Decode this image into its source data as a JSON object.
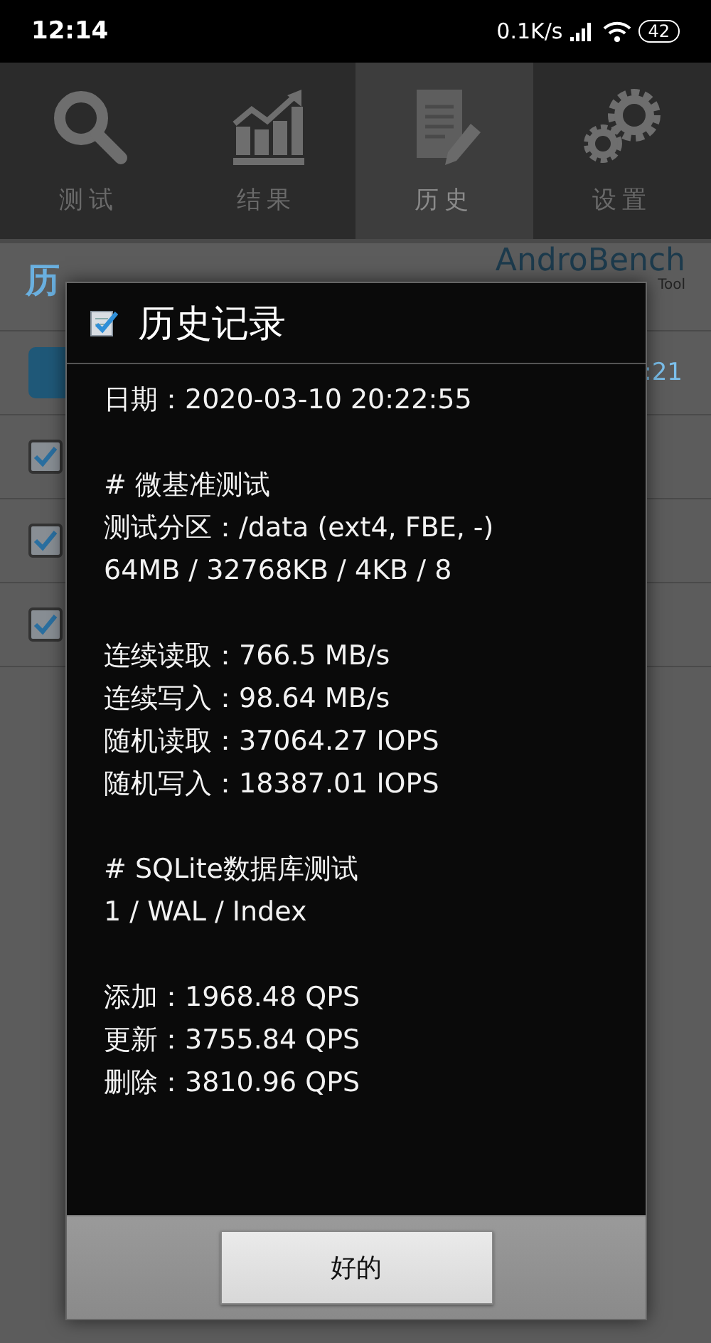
{
  "status_bar": {
    "time": "12:14",
    "speed": "0.1K/s",
    "battery": "42"
  },
  "tabs": [
    {
      "label": "测试",
      "selected": false
    },
    {
      "label": "结果",
      "selected": false
    },
    {
      "label": "历史",
      "selected": true
    },
    {
      "label": "设置",
      "selected": false
    }
  ],
  "page": {
    "title": "历",
    "logo": "AndroBench",
    "tagline": "Tool",
    "first_row_time": ":21",
    "rows": [
      {
        "checked": true
      },
      {
        "checked": true
      },
      {
        "checked": true
      }
    ]
  },
  "dialog": {
    "title": "历史记录",
    "sections": [
      [
        "日期：2020-03-10 20:22:55"
      ],
      [
        "# 微基准测试",
        "测试分区：/data (ext4, FBE, -)",
        "64MB / 32768KB / 4KB / 8"
      ],
      [
        "连续读取：766.5 MB/s",
        "连续写入：98.64 MB/s",
        "随机读取：37064.27 IOPS",
        "随机写入：18387.01 IOPS"
      ],
      [
        "# SQLite数据库测试",
        "1 / WAL / Index"
      ],
      [
        "添加：1968.48 QPS",
        "更新：3755.84 QPS",
        "删除：3810.96 QPS"
      ]
    ],
    "button": "好的"
  }
}
